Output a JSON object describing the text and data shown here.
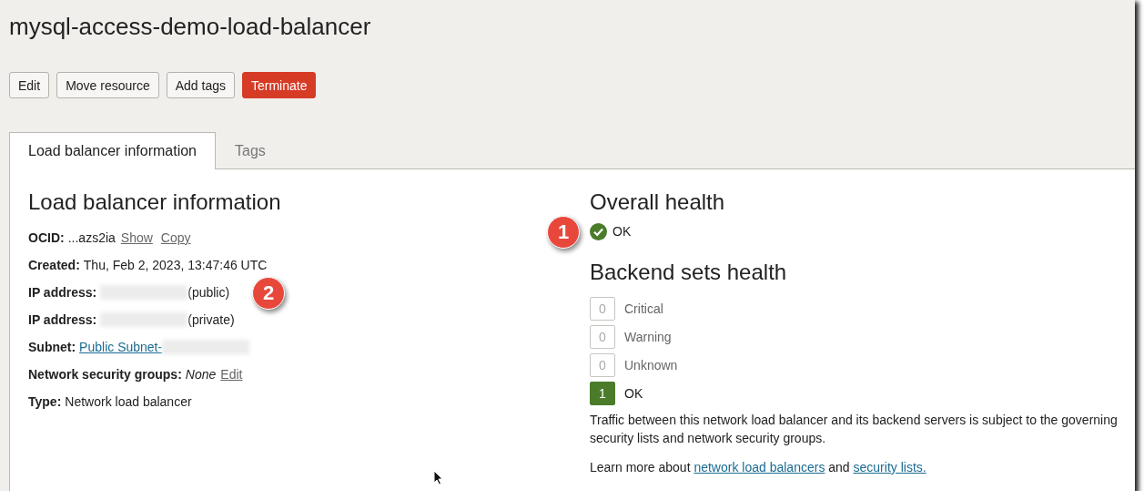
{
  "title": "mysql-access-demo-load-balancer",
  "actions": [
    {
      "label": "Edit",
      "kind": "default"
    },
    {
      "label": "Move resource",
      "kind": "default"
    },
    {
      "label": "Add tags",
      "kind": "default"
    },
    {
      "label": "Terminate",
      "kind": "danger"
    }
  ],
  "tabs": [
    {
      "label": "Load balancer information",
      "selected": true
    },
    {
      "label": "Tags",
      "selected": false
    }
  ],
  "info": {
    "heading": "Load balancer information",
    "rows": [
      {
        "label": "OCID:",
        "parts": [
          {
            "kind": "text",
            "text": "...azs2ia"
          },
          {
            "kind": "action",
            "text": "Show"
          },
          {
            "kind": "action",
            "text": "Copy"
          }
        ]
      },
      {
        "label": "Created:",
        "parts": [
          {
            "kind": "text",
            "text": "Thu, Feb 2, 2023, 13:47:46 UTC"
          }
        ]
      },
      {
        "label": "IP address:",
        "callout": "2",
        "parts": [
          {
            "kind": "redacted"
          },
          {
            "kind": "text",
            "text": "(public)"
          }
        ]
      },
      {
        "label": "IP address:",
        "parts": [
          {
            "kind": "redacted"
          },
          {
            "kind": "text",
            "text": "(private)"
          }
        ]
      },
      {
        "label": "Subnet:",
        "parts": [
          {
            "kind": "link",
            "text": "Public Subnet-"
          },
          {
            "kind": "redacted"
          }
        ]
      },
      {
        "label": "Network security groups:",
        "parts": [
          {
            "kind": "emphasis",
            "text": "None"
          },
          {
            "kind": "action",
            "text": "Edit"
          }
        ]
      },
      {
        "label": "Type:",
        "parts": [
          {
            "kind": "text",
            "text": "Network load balancer"
          }
        ]
      }
    ]
  },
  "overall_health": {
    "heading": "Overall health",
    "status": "OK",
    "callout": "1"
  },
  "backend_health": {
    "heading": "Backend sets health",
    "items": [
      {
        "count": "0",
        "label": "Critical",
        "active": false
      },
      {
        "count": "0",
        "label": "Warning",
        "active": false
      },
      {
        "count": "0",
        "label": "Unknown",
        "active": false
      },
      {
        "count": "1",
        "label": "OK",
        "active": true
      }
    ]
  },
  "note": "Traffic between this network load balancer and its backend servers is subject to the governing security lists and network security groups.",
  "learn_more": [
    {
      "kind": "text",
      "text": "Learn more about "
    },
    {
      "kind": "link",
      "text": "network load balancers"
    },
    {
      "kind": "text",
      "text": " and "
    },
    {
      "kind": "link",
      "text": "security lists."
    }
  ]
}
